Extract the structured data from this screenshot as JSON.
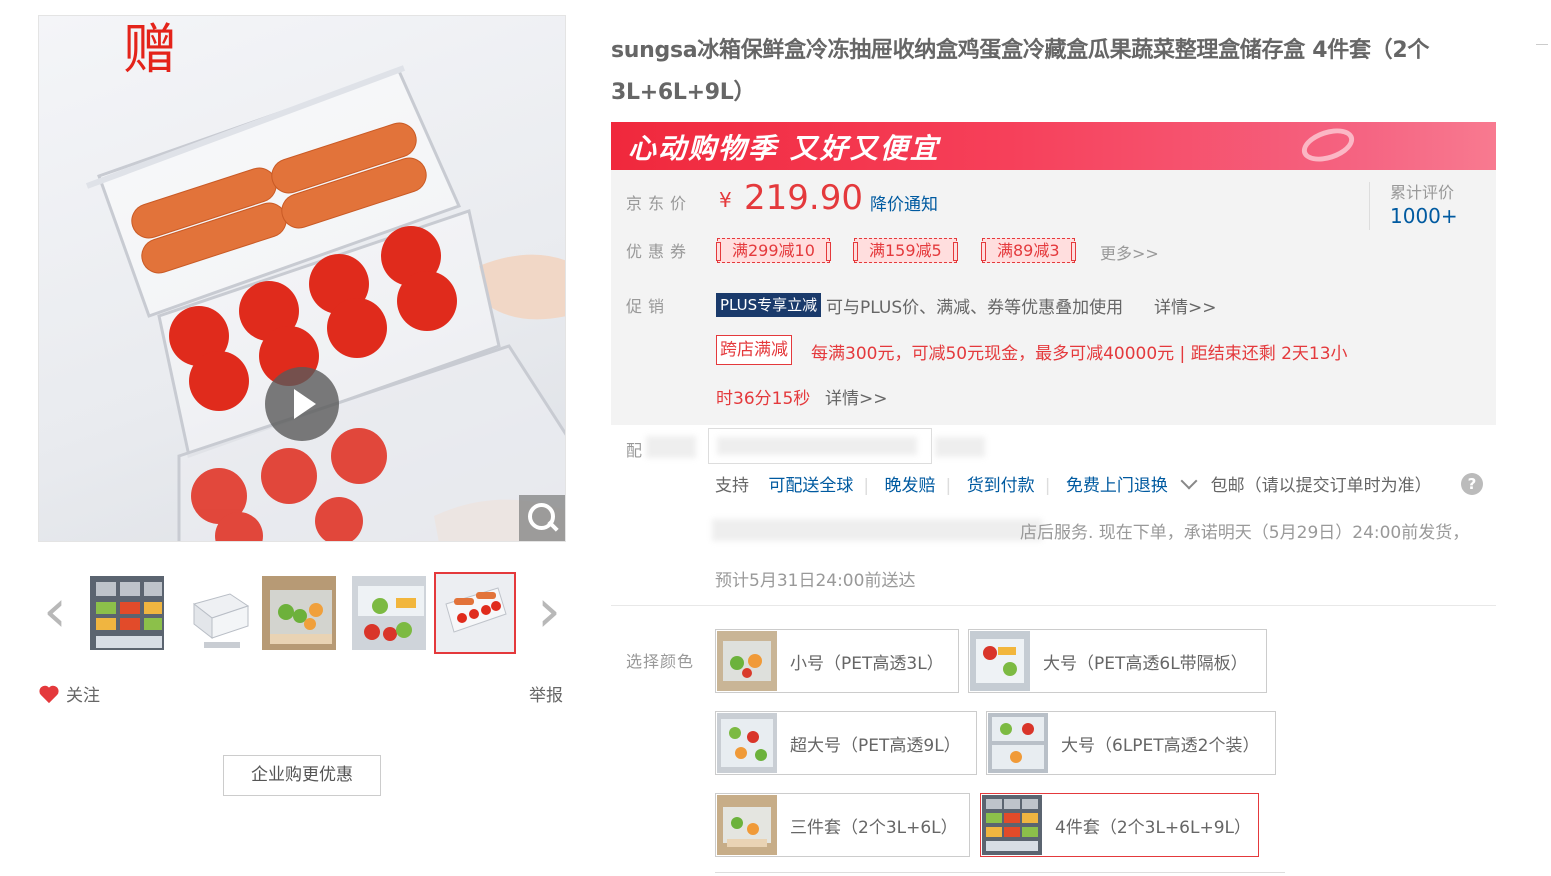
{
  "gallery": {
    "gift_mark": "赠",
    "icons": {
      "play": "play-icon",
      "zoom": "magnifier-icon",
      "prev": "chevron-left-icon",
      "next": "chevron-right-icon",
      "follow": "heart-icon"
    },
    "follow_label": "关注",
    "report_label": "举报",
    "enterprise_button": "企业购更优惠",
    "thumbnail_count": 5,
    "active_thumbnail": 5
  },
  "product": {
    "title": "sungsa冰箱保鲜盒冷冻抽屉收纳盒鸡蛋盒冷藏盒瓜果蔬菜整理盒储存盒 4件套（2个3L+6L+9L）"
  },
  "banner": {
    "text": "心动购物季  又好又便宜",
    "colors": {
      "start": "#f0283c",
      "end": "#f87a90"
    }
  },
  "price": {
    "label": "京东价",
    "currency": "¥",
    "value": "219.90",
    "notify_link": "降价通知",
    "review_label": "累计评价",
    "review_count": "1000+"
  },
  "coupons": {
    "label": "优惠券",
    "items": [
      "满299减10",
      "满159减5",
      "满89减3"
    ],
    "more": "更多>>"
  },
  "promotion": {
    "label": "促销",
    "plus_tag": "PLUS专享立减",
    "plus_text": "可与PLUS价、满减、券等优惠叠加使用",
    "plus_detail": "详情>>",
    "cross_tag": "跨店满减",
    "cross_text_1": "每满300元，可减50元现金，最多可减40000元 | 距结束还剩 2天13小",
    "cross_text_2": "时36分15秒",
    "cross_detail": "详情>>"
  },
  "delivery": {
    "label_partial": "配",
    "support_prefix": "支持",
    "support_items": [
      "可配送全球",
      "晚发赔",
      "货到付款",
      "免费上门退换"
    ],
    "shipping": "包邮（请以提交订单时为准）",
    "help_icon": "question-icon",
    "service_line_1": "店后服务. 现在下单，承诺明天（5月29日）24:00前发货，",
    "service_line_2": "预计5月31日24:00前送达"
  },
  "variants": {
    "label": "选择颜色",
    "options": [
      {
        "label": "小号（PET高透3L）",
        "selected": false
      },
      {
        "label": "大号（PET高透6L带隔板）",
        "selected": false
      },
      {
        "label": "超大号（PET高透9L）",
        "selected": false
      },
      {
        "label": "大号（6LPET高透2个装）",
        "selected": false
      },
      {
        "label": "三件套（2个3L+6L）",
        "selected": false
      },
      {
        "label": "4件套（2个3L+6L+9L）",
        "selected": true
      }
    ]
  },
  "theme": {
    "accent_red": "#e4393c",
    "link_blue": "#005aa0",
    "plus_navy": "#1a3a6b"
  }
}
